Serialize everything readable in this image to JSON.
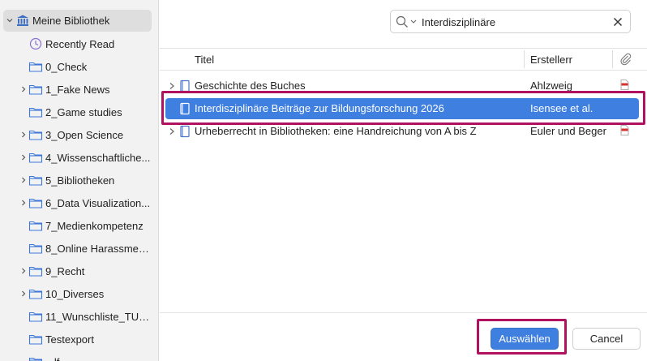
{
  "sidebar": {
    "root": {
      "label": "Meine Bibliothek",
      "icon": "library-icon"
    },
    "items": [
      {
        "label": "Recently Read",
        "icon": "clock-icon",
        "expandable": false
      },
      {
        "label": "0_Check",
        "icon": "folder-icon",
        "expandable": false
      },
      {
        "label": "1_Fake News",
        "icon": "folder-icon",
        "expandable": true
      },
      {
        "label": "2_Game studies",
        "icon": "folder-icon",
        "expandable": false
      },
      {
        "label": "3_Open Science",
        "icon": "folder-icon",
        "expandable": true
      },
      {
        "label": "4_Wissenschaftliche...",
        "icon": "folder-icon",
        "expandable": true
      },
      {
        "label": "5_Bibliotheken",
        "icon": "folder-icon",
        "expandable": true
      },
      {
        "label": "6_Data Visualization...",
        "icon": "folder-icon",
        "expandable": true
      },
      {
        "label": "7_Medienkompetenz",
        "icon": "folder-icon",
        "expandable": false
      },
      {
        "label": "8_Online Harassmen...",
        "icon": "folder-icon",
        "expandable": false
      },
      {
        "label": "9_Recht",
        "icon": "folder-icon",
        "expandable": true
      },
      {
        "label": "10_Diverses",
        "icon": "folder-icon",
        "expandable": true
      },
      {
        "label": "11_Wunschliste_TUB...",
        "icon": "folder-icon",
        "expandable": false
      },
      {
        "label": "Testexport",
        "icon": "folder-icon",
        "expandable": false
      },
      {
        "label": "...lf...",
        "icon": "folder-icon",
        "expandable": false
      }
    ]
  },
  "search": {
    "value": "Interdisziplinäre"
  },
  "columns": {
    "title": "Titel",
    "creator": "Erstellerr",
    "attachment_icon": "paperclip-icon"
  },
  "items": [
    {
      "title": "Geschichte des Buches",
      "creator": "Ahlzweig",
      "type_icon": "book-icon",
      "has_pdf": true,
      "selected": false
    },
    {
      "title": "Interdisziplinäre Beiträge zur Bildungsforschung 2026",
      "creator": "Isensee et al.",
      "type_icon": "book-icon",
      "has_pdf": false,
      "selected": true
    },
    {
      "title": "Urheberrecht in Bibliotheken: eine Handreichung von A bis Z",
      "creator": "Euler und Beger",
      "type_icon": "book-icon",
      "has_pdf": true,
      "selected": false
    }
  ],
  "buttons": {
    "select": "Auswählen",
    "cancel": "Cancel"
  },
  "colors": {
    "accent": "#3f7fe0",
    "highlight": "#b0125f"
  }
}
